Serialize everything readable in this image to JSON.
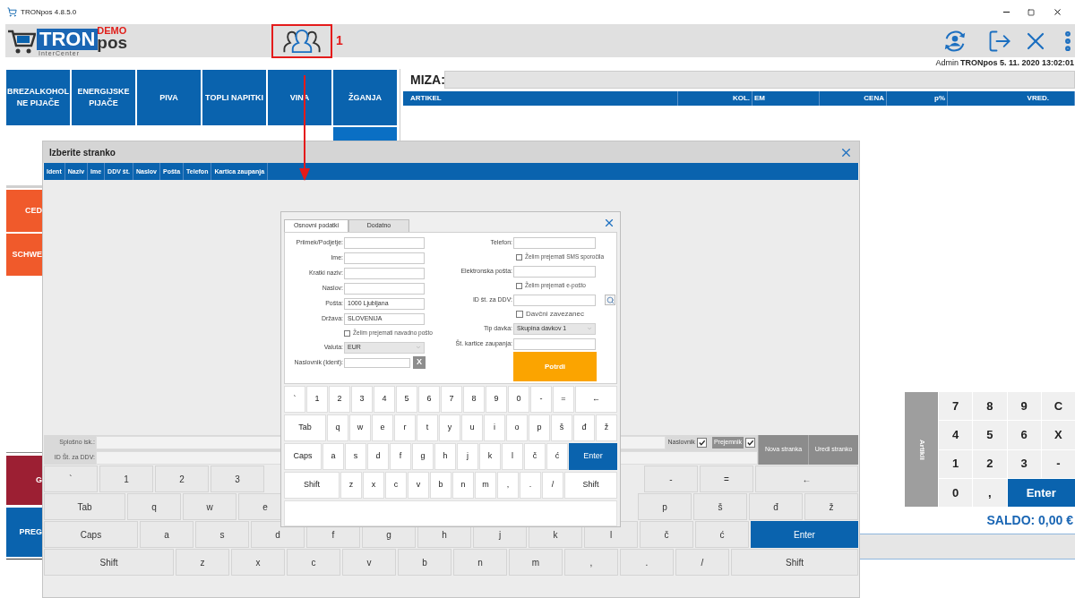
{
  "title_bar": {
    "title": "TRONpos 4.8.5.0"
  },
  "logo": {
    "name": "TRON",
    "badge": "DEMO",
    "suffix": "pos",
    "company": "InterCenter"
  },
  "annotation": {
    "label": "1"
  },
  "session_info": {
    "user": "Admin",
    "details": "TRONpos 5. 11. 2020 13:02:01"
  },
  "categories": [
    {
      "label": "BREZALKOHOL NE PIJAČE"
    },
    {
      "label": "ENERGIJSKE PIJAČE"
    },
    {
      "label": "PIVA"
    },
    {
      "label": "TOPLI NAPITKI"
    },
    {
      "label": "VINA"
    },
    {
      "label": "ŽGANJA"
    }
  ],
  "upper_tiles": [
    {
      "label": "CED",
      "color": "#f05a2b"
    },
    {
      "label": "SCHWE",
      "color": "#f05a2b"
    }
  ],
  "lower_tiles": [
    {
      "label": "G",
      "color": "#9c1f33"
    },
    {
      "label": "PREG",
      "color": "#0a63ae"
    }
  ],
  "order": {
    "table_label": "MIZA:",
    "columns": [
      "ARTIKEL",
      "KOL.",
      "EM",
      "CENA",
      "p%",
      "VRED."
    ]
  },
  "numpad": {
    "side_label": "Artikli",
    "keys": [
      {
        "label": "7",
        "kind": "digit"
      },
      {
        "label": "8",
        "kind": "digit"
      },
      {
        "label": "9",
        "kind": "digit"
      },
      {
        "label": "C",
        "kind": "digit"
      },
      {
        "label": "4",
        "kind": "digit"
      },
      {
        "label": "5",
        "kind": "digit"
      },
      {
        "label": "6",
        "kind": "digit"
      },
      {
        "label": "X",
        "kind": "digit"
      },
      {
        "label": "1",
        "kind": "digit"
      },
      {
        "label": "2",
        "kind": "digit"
      },
      {
        "label": "3",
        "kind": "digit"
      },
      {
        "label": "-",
        "kind": "digit"
      },
      {
        "label": "0",
        "kind": "digit"
      },
      {
        "label": ",",
        "kind": "digit"
      },
      {
        "label": "Enter",
        "kind": "enter"
      }
    ]
  },
  "saldo": "SALDO: 0,00 €",
  "customer_dialog": {
    "title": "Izberite stranko",
    "columns": [
      "Ident",
      "Naziv",
      "Ime",
      "DDV št.",
      "Naslov",
      "Pošta",
      "Telefon",
      "Kartica zaupanja"
    ],
    "discount_label": "Splošno isk.:",
    "vat_label": "ID Št. za DDV:",
    "options": [
      {
        "label": "Naslovnik",
        "checked": true,
        "kind": "plain"
      },
      {
        "label": "Prejemnik",
        "checked": true,
        "kind": "highlighted"
      }
    ],
    "buttons": [
      "Nova stranka",
      "Uredi stranko"
    ],
    "keyboard": [
      {
        "left": [
          {
            "label": "`",
            "kind": "char"
          },
          {
            "label": "1",
            "kind": "char"
          },
          {
            "label": "2",
            "kind": "char"
          },
          {
            "label": "3",
            "kind": "char"
          }
        ],
        "right": [
          {
            "label": "-",
            "kind": "char"
          },
          {
            "label": "=",
            "kind": "char"
          },
          {
            "label": "←",
            "kind": "backspace"
          }
        ]
      },
      {
        "left": [
          {
            "label": "Tab",
            "kind": "tab"
          },
          {
            "label": "q",
            "kind": "char"
          },
          {
            "label": "w",
            "kind": "char"
          },
          {
            "label": "e",
            "kind": "char"
          }
        ],
        "right": [
          {
            "label": "p",
            "kind": "char"
          },
          {
            "label": "š",
            "kind": "char"
          },
          {
            "label": "đ",
            "kind": "char"
          },
          {
            "label": "ž",
            "kind": "char"
          }
        ]
      },
      {
        "left": [
          {
            "label": "Caps",
            "kind": "caps"
          },
          {
            "label": "a",
            "kind": "char"
          },
          {
            "label": "s",
            "kind": "char"
          },
          {
            "label": "d",
            "kind": "char"
          },
          {
            "label": "f",
            "kind": "char"
          },
          {
            "label": "g",
            "kind": "char"
          },
          {
            "label": "h",
            "kind": "char"
          },
          {
            "label": "j",
            "kind": "char"
          },
          {
            "label": "k",
            "kind": "char"
          },
          {
            "label": "l",
            "kind": "char"
          },
          {
            "label": "č",
            "kind": "char"
          },
          {
            "label": "ć",
            "kind": "char"
          },
          {
            "label": "Enter",
            "kind": "enter"
          }
        ]
      },
      {
        "left": [
          {
            "label": "Shift",
            "kind": "shift"
          },
          {
            "label": "z",
            "kind": "char"
          },
          {
            "label": "x",
            "kind": "char"
          },
          {
            "label": "c",
            "kind": "char"
          },
          {
            "label": "v",
            "kind": "char"
          },
          {
            "label": "b",
            "kind": "char"
          },
          {
            "label": "n",
            "kind": "char"
          },
          {
            "label": "m",
            "kind": "char"
          },
          {
            "label": ",",
            "kind": "char"
          },
          {
            "label": ".",
            "kind": "char"
          },
          {
            "label": "/",
            "kind": "char"
          },
          {
            "label": "Shift",
            "kind": "shift_right"
          }
        ]
      }
    ]
  },
  "edit_dialog": {
    "tabs": [
      {
        "label": "Osnovni podatki",
        "selected": true
      },
      {
        "label": "Dodatno",
        "selected": false
      }
    ],
    "left_fields": [
      {
        "kind": "text",
        "label": "Priimek/Podjetje:"
      },
      {
        "kind": "text",
        "label": "Ime:"
      },
      {
        "kind": "text",
        "label": "Kratki naziv:"
      },
      {
        "kind": "text",
        "label": "Naslov:"
      },
      {
        "kind": "text",
        "label": "Pošta:",
        "value": "1000 Ljubljana"
      },
      {
        "kind": "text",
        "label": "Država:",
        "value": "SLOVENIJA"
      },
      {
        "kind": "checkbox",
        "label": "Želim prejemati navadno pošto",
        "checked": false
      },
      {
        "kind": "select",
        "label": "Valuta:",
        "value": "EUR"
      },
      {
        "kind": "clearable",
        "label": "Naslovnik (Ident):",
        "button": "X"
      }
    ],
    "right_fields": [
      {
        "kind": "text",
        "label": "Telefon:"
      },
      {
        "kind": "checkbox",
        "label": "Želim prejemati SMS sporočila",
        "checked": false
      },
      {
        "kind": "text",
        "label": "Elektronska pošta:"
      },
      {
        "kind": "checkbox",
        "label": "Želim prejemati e-pošto",
        "checked": false
      },
      {
        "kind": "lookup",
        "label": "ID št. za DDV:"
      },
      {
        "kind": "checkbox",
        "label": "Davčni zavezanec",
        "checked": false
      },
      {
        "kind": "select",
        "label": "Tip davka:",
        "value": "Skupina davkov 1"
      },
      {
        "kind": "text",
        "label": "Št. kartice zaupanja:"
      }
    ],
    "confirm": "Potrdi",
    "keyboard": [
      [
        {
          "label": "`",
          "kind": "char"
        },
        {
          "label": "1",
          "kind": "char"
        },
        {
          "label": "2",
          "kind": "char"
        },
        {
          "label": "3",
          "kind": "char"
        },
        {
          "label": "4",
          "kind": "char"
        },
        {
          "label": "5",
          "kind": "char"
        },
        {
          "label": "6",
          "kind": "char"
        },
        {
          "label": "7",
          "kind": "char"
        },
        {
          "label": "8",
          "kind": "char"
        },
        {
          "label": "9",
          "kind": "char"
        },
        {
          "label": "0",
          "kind": "char"
        },
        {
          "label": "-",
          "kind": "char"
        },
        {
          "label": "=",
          "kind": "char"
        },
        {
          "label": "←",
          "kind": "backspace"
        }
      ],
      [
        {
          "label": "Tab",
          "kind": "tab"
        },
        {
          "label": "q",
          "kind": "char"
        },
        {
          "label": "w",
          "kind": "char"
        },
        {
          "label": "e",
          "kind": "char"
        },
        {
          "label": "r",
          "kind": "char"
        },
        {
          "label": "t",
          "kind": "char"
        },
        {
          "label": "y",
          "kind": "char"
        },
        {
          "label": "u",
          "kind": "char"
        },
        {
          "label": "i",
          "kind": "char"
        },
        {
          "label": "o",
          "kind": "char"
        },
        {
          "label": "p",
          "kind": "char"
        },
        {
          "label": "š",
          "kind": "char"
        },
        {
          "label": "đ",
          "kind": "char"
        },
        {
          "label": "ž",
          "kind": "char"
        }
      ],
      [
        {
          "label": "Caps",
          "kind": "caps"
        },
        {
          "label": "a",
          "kind": "char"
        },
        {
          "label": "s",
          "kind": "char"
        },
        {
          "label": "d",
          "kind": "char"
        },
        {
          "label": "f",
          "kind": "char"
        },
        {
          "label": "g",
          "kind": "char"
        },
        {
          "label": "h",
          "kind": "char"
        },
        {
          "label": "j",
          "kind": "char"
        },
        {
          "label": "k",
          "kind": "char"
        },
        {
          "label": "l",
          "kind": "char"
        },
        {
          "label": "č",
          "kind": "char"
        },
        {
          "label": "ć",
          "kind": "char"
        },
        {
          "label": "Enter",
          "kind": "enter"
        }
      ],
      [
        {
          "label": "Shift",
          "kind": "shift"
        },
        {
          "label": "z",
          "kind": "char"
        },
        {
          "label": "x",
          "kind": "char"
        },
        {
          "label": "c",
          "kind": "char"
        },
        {
          "label": "v",
          "kind": "char"
        },
        {
          "label": "b",
          "kind": "char"
        },
        {
          "label": "n",
          "kind": "char"
        },
        {
          "label": "m",
          "kind": "char"
        },
        {
          "label": ",",
          "kind": "char"
        },
        {
          "label": ".",
          "kind": "char"
        },
        {
          "label": "/",
          "kind": "char"
        },
        {
          "label": "Shift",
          "kind": "shift_right"
        }
      ]
    ]
  }
}
